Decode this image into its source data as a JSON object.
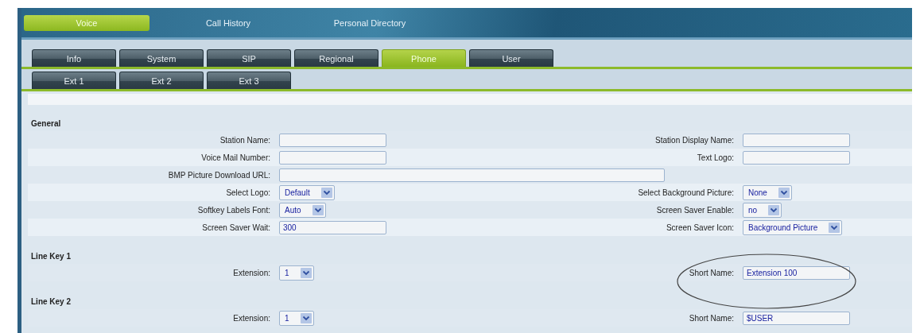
{
  "top_tabs": [
    {
      "label": "Voice",
      "selected": true
    },
    {
      "label": "Call History",
      "selected": false
    },
    {
      "label": "Personal Directory",
      "selected": false
    }
  ],
  "tabs": [
    {
      "label": "Info",
      "selected": false
    },
    {
      "label": "System",
      "selected": false
    },
    {
      "label": "SIP",
      "selected": false
    },
    {
      "label": "Regional",
      "selected": false
    },
    {
      "label": "Phone",
      "selected": true
    },
    {
      "label": "User",
      "selected": false
    }
  ],
  "sub_tabs": [
    {
      "label": "Ext 1",
      "selected": false
    },
    {
      "label": "Ext 2",
      "selected": false
    },
    {
      "label": "Ext 3",
      "selected": false
    }
  ],
  "sections": [
    {
      "title": "General",
      "rows": [
        {
          "left": {
            "label": "Station Name:",
            "kind": "text"
          },
          "right": {
            "label": "Station Display Name:",
            "kind": "text"
          }
        },
        {
          "left": {
            "label": "Voice Mail Number:",
            "kind": "text"
          },
          "right": {
            "label": "Text Logo:",
            "kind": "text"
          }
        },
        {
          "left": {
            "label": "BMP Picture Download URL:",
            "kind": "wide"
          }
        },
        {
          "left": {
            "label": "Select Logo:",
            "kind": "select",
            "value": "Default"
          },
          "right": {
            "label": "Select Background Picture:",
            "kind": "select",
            "value": "None"
          }
        },
        {
          "left": {
            "label": "Softkey Labels Font:",
            "kind": "select",
            "value": "Auto"
          },
          "right": {
            "label": "Screen Saver Enable:",
            "kind": "select",
            "value": "no"
          }
        },
        {
          "left": {
            "label": "Screen Saver Wait:",
            "kind": "text",
            "value": "300"
          },
          "right": {
            "label": "Screen Saver Icon:",
            "kind": "select",
            "value": "Background Picture"
          }
        }
      ]
    },
    {
      "title": "Line Key 1",
      "rows": [
        {
          "left": {
            "label": "Extension:",
            "kind": "select",
            "value": "1"
          },
          "right": {
            "label": "Short Name:",
            "kind": "text",
            "value": "Extension 100",
            "circled": true
          }
        }
      ]
    },
    {
      "title": "Line Key 2",
      "rows": [
        {
          "left": {
            "label": "Extension:",
            "kind": "select",
            "value": "1"
          },
          "right": {
            "label": "Short Name:",
            "kind": "text",
            "value": "$USER",
            "circled": false
          }
        }
      ]
    }
  ]
}
